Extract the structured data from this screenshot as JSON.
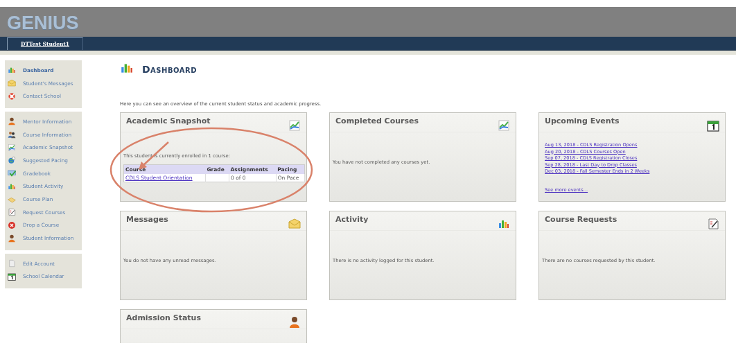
{
  "header": {
    "logo": "GENIUS"
  },
  "nav": {
    "tabs": [
      {
        "label": "DTTest Student1"
      }
    ]
  },
  "sidebar": {
    "groups": [
      {
        "items": [
          {
            "label": "Dashboard",
            "selected": true
          },
          {
            "label": "Student's Messages",
            "selected": false
          },
          {
            "label": "Contact School",
            "selected": false
          }
        ]
      },
      {
        "items": [
          {
            "label": "Mentor Information",
            "selected": false
          },
          {
            "label": "Course Information",
            "selected": false
          },
          {
            "label": "Academic Snapshot",
            "selected": false
          },
          {
            "label": "Suggested Pacing",
            "selected": false
          },
          {
            "label": "Gradebook",
            "selected": false
          },
          {
            "label": "Student Activity",
            "selected": false
          },
          {
            "label": "Course Plan",
            "selected": false
          },
          {
            "label": "Request Courses",
            "selected": false
          },
          {
            "label": "Drop a Course",
            "selected": false
          },
          {
            "label": "Student Information",
            "selected": false
          }
        ]
      },
      {
        "items": [
          {
            "label": "Edit Account",
            "selected": false
          },
          {
            "label": "School Calendar",
            "selected": false
          }
        ]
      }
    ]
  },
  "page": {
    "title": "Dashboard",
    "intro": "Here you can see an overview of the current student status and academic progress."
  },
  "cards": [
    {
      "title": "Academic Snapshot",
      "kind": "table",
      "text": "This student is currently enrolled in 1 course:",
      "columns": [
        "Course",
        "Grade",
        "Assignments",
        "Pacing"
      ],
      "rows": [
        {
          "course": "CDLS Student Orientation",
          "assignments": "0 of 0",
          "pacing": "On Pace"
        }
      ]
    },
    {
      "title": "Completed Courses",
      "kind": "text",
      "text": "You have not completed any courses yet."
    },
    {
      "title": "Upcoming Events",
      "kind": "events",
      "events": [
        "Aug 13, 2018 - CDLS Registration Opens",
        "Aug 20, 2018 - CDLS Courses Open",
        "Sep 07, 2018 - CDLS Registration Closes",
        "Sep 28, 2018 - Last Day to Drop Classes",
        "Dec 03, 2018 - Fall Semester Ends in 2 Weeks"
      ],
      "more": "See more events..."
    },
    {
      "title": "Messages",
      "kind": "text",
      "text": "You do not have any unread messages."
    },
    {
      "title": "Activity",
      "kind": "text",
      "text": "There is no activity logged for this student."
    },
    {
      "title": "Course Requests",
      "kind": "text",
      "text": "There are no courses requested by this student."
    },
    {
      "title": "Admission Status",
      "kind": "text"
    }
  ]
}
